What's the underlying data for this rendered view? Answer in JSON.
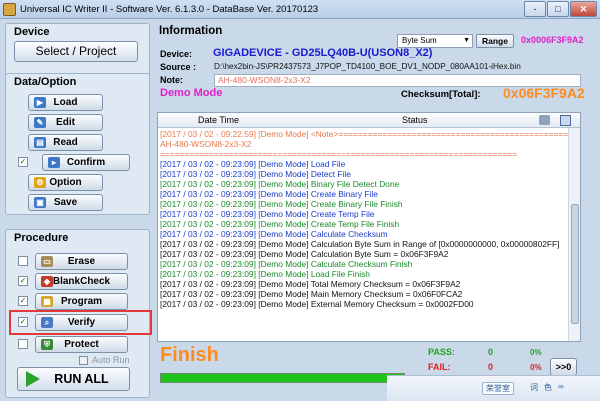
{
  "window": {
    "title": "Universal IC Writer II - Software Ver. 6.1.3.0 - DataBase Ver. 20170123",
    "min": "-",
    "max": "□",
    "close": "✕"
  },
  "device_group": {
    "title": "Device",
    "select_project": "Select / Project"
  },
  "data_group": {
    "title": "Data/Option",
    "load": "Load",
    "edit": "Edit",
    "read": "Read",
    "confirm": "Confirm",
    "option": "Option",
    "save": "Save"
  },
  "procedure_group": {
    "title": "Procedure",
    "erase": "Erase",
    "blankcheck": "BlankCheck",
    "program": "Program",
    "verify": "Verify",
    "protect": "Protect",
    "auto_run": "Auto Run",
    "run_all": "RUN ALL"
  },
  "information": {
    "title": "Information",
    "device_label": "Device:",
    "device_value": "GIGADEVICE - GD25LQ40B-U(USON8_X2)",
    "source_label": "Source :",
    "source_value": "D:\\hex2bin-JS\\PR2437573_J7POP_TD4100_BOE_DV1_NODP_080AA101-iHex.bin",
    "note_label": "Note:",
    "note_value": "AH-480-WSON8-2x3-X2",
    "checksum_mode": "Byte Sum",
    "range_button": "Range",
    "checksum_small": "0x0006F3F9A2",
    "demo_mode": "Demo Mode",
    "checksum_total_label": "Checksum[Total]:",
    "checksum_total_value": "0x06F3F9A2"
  },
  "log": {
    "col_datetime": "Date Time",
    "col_status": "Status",
    "rows": [
      {
        "text": "[2017 / 03 / 02 - 09:22:59] [Demo Mode] <Note>=====================================================",
        "color": "#e8784a"
      },
      {
        "text": "AH-480-WSON8-2x3-X2",
        "color": "#e8784a"
      },
      {
        "text": "=========================================================================",
        "color": "#e8784a"
      },
      {
        "text": "[2017 / 03 / 02 - 09:23:09] [Demo Mode] Load File",
        "color": "#1a3ccf"
      },
      {
        "text": "[2017 / 03 / 02 - 09:23:09] [Demo Mode] Detect File",
        "color": "#1a3ccf"
      },
      {
        "text": "[2017 / 03 / 02 - 09:23:09] [Demo Mode] Binary File Detect Done",
        "color": "#1a8a2a"
      },
      {
        "text": "[2017 / 03 / 02 - 09:23:09] [Demo Mode] Create Binary File",
        "color": "#1a3ccf"
      },
      {
        "text": "[2017 / 03 / 02 - 09:23:09] [Demo Mode] Create Binary File Finish",
        "color": "#1a8a2a"
      },
      {
        "text": "[2017 / 03 / 02 - 09:23:09] [Demo Mode] Create Temp File",
        "color": "#1a3ccf"
      },
      {
        "text": "[2017 / 03 / 02 - 09:23:09] [Demo Mode] Create Temp File Finish",
        "color": "#1a8a2a"
      },
      {
        "text": "[2017 / 03 / 02 - 09:23:09] [Demo Mode] Calculate Checksum",
        "color": "#1a3ccf"
      },
      {
        "text": "[2017 / 03 / 02 - 09:23:09] [Demo Mode] Calculation Byte Sum in Range of [0x0000000000, 0x00000802FF]",
        "color": "#111111"
      },
      {
        "text": "[2017 / 03 / 02 - 09:23:09] [Demo Mode] Calculation Byte Sum = 0x06F3F9A2",
        "color": "#111111"
      },
      {
        "text": "[2017 / 03 / 02 - 09:23:09] [Demo Mode] Calculate Checksum Finish",
        "color": "#1a8a2a"
      },
      {
        "text": "[2017 / 03 / 02 - 09:23:09] [Demo Mode] Load File Finish",
        "color": "#1a8a2a"
      },
      {
        "text": "[2017 / 03 / 02 - 09:23:09] [Demo Mode] Total Memory Checksum = 0x06F3F9A2",
        "color": "#111111"
      },
      {
        "text": "[2017 / 03 / 02 - 09:23:09] [Demo Mode] Main Memory Checksum = 0x06F0FCA2",
        "color": "#111111"
      },
      {
        "text": "[2017 / 03 / 02 - 09:23:09] [Demo Mode] External Memory Checksum = 0x0002FD00",
        "color": "#111111"
      }
    ]
  },
  "status": {
    "finish": "Finish",
    "progress": 1.0,
    "pass_label": "PASS:",
    "pass_count": "0",
    "pass_pct": "0%",
    "fail_label": "FAIL:",
    "fail_count": "0",
    "fail_pct": "0%",
    "next_button": ">>0"
  },
  "taskbar": {
    "label": "荣誉室",
    "items": [
      "词",
      "色",
      "∞"
    ]
  },
  "colors": {
    "window_bg": "#c9d9ea",
    "accent_magenta": "#e020c8",
    "finish_orange": "#ff8a1e",
    "progress_green": "#1ec31e",
    "highlight_red": "#e23a3a"
  }
}
